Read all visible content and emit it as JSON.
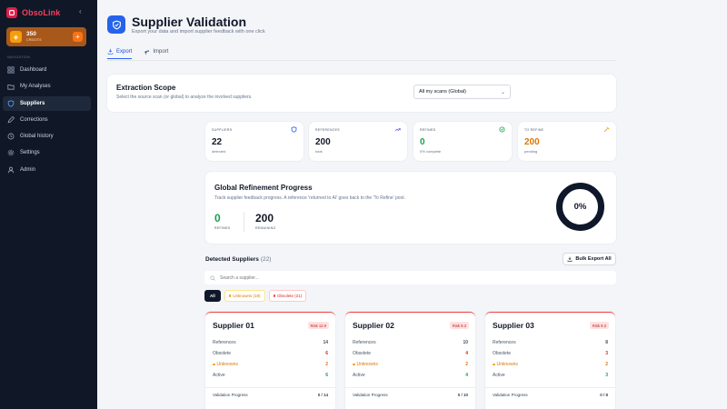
{
  "brand": {
    "name": "ObsoLink"
  },
  "credits": {
    "amount": "350",
    "label": "CREDITS"
  },
  "nav": {
    "title": "NAVIGATION",
    "items": [
      {
        "label": "Dashboard",
        "icon": "grid-icon"
      },
      {
        "label": "My Analyses",
        "icon": "folder-icon"
      },
      {
        "label": "Suppliers",
        "icon": "shield-icon",
        "active": true
      },
      {
        "label": "Corrections",
        "icon": "pencil-icon"
      },
      {
        "label": "Global history",
        "icon": "history-icon"
      },
      {
        "label": "Settings",
        "icon": "gear-icon"
      },
      {
        "label": "Admin",
        "icon": "user-icon"
      }
    ]
  },
  "header": {
    "title": "Supplier Validation",
    "subtitle": "Export your data and import supplier feedback with one click"
  },
  "tabs": [
    {
      "label": "Export",
      "active": true
    },
    {
      "label": "Import",
      "active": false
    }
  ],
  "scope": {
    "title": "Extraction Scope",
    "description": "Select the source scan (or global) to analyze the involved suppliers.",
    "select_value": "All my scans (Global)"
  },
  "stats": [
    {
      "label": "SUPPLIERS",
      "value": "22",
      "sub": "detected",
      "color": "#111827",
      "icon": "shield-icon"
    },
    {
      "label": "REFERENCES",
      "value": "200",
      "sub": "total",
      "color": "#111827",
      "icon": "trend-icon"
    },
    {
      "label": "REFINED",
      "value": "0",
      "sub": "0% complete",
      "color": "#16a34a",
      "icon": "check-circle-icon"
    },
    {
      "label": "TO REFINE",
      "value": "200",
      "sub": "pending",
      "color": "#d97706",
      "icon": "wand-icon"
    }
  ],
  "progress": {
    "title": "Global Refinement Progress",
    "description": "Track supplier feedback progress. A reference 'returned to AI' goes back to the 'To Refine' pool.",
    "refined_value": "0",
    "refined_label": "REFINED",
    "remaining_value": "200",
    "remaining_label": "REMAINING",
    "percent_text": "0%",
    "percent": 0
  },
  "detected": {
    "title": "Detected Suppliers",
    "count": "(22)",
    "bulk_label": "Bulk Export All",
    "search_placeholder": "Search a supplier...",
    "filters": {
      "all": "All",
      "unknowns": "Unknowns (19)",
      "obsolete": "Obsolete (21)"
    }
  },
  "row_labels": {
    "references": "References",
    "obsolete": "Obsolete",
    "unknowns": "Unknowns",
    "active": "Active",
    "validation": "Validation Progress"
  },
  "suppliers": [
    {
      "name": "Supplier 01",
      "risk": "Risk 12.9",
      "references": "14",
      "obsolete": "6",
      "unknowns": "2",
      "active": "6",
      "progress": "0 / 14"
    },
    {
      "name": "Supplier 02",
      "risk": "Risk 9.3",
      "references": "10",
      "obsolete": "4",
      "unknowns": "2",
      "active": "4",
      "progress": "0 / 10"
    },
    {
      "name": "Supplier 03",
      "risk": "Risk 9.3",
      "references": "8",
      "obsolete": "3",
      "unknowns": "2",
      "active": "3",
      "progress": "0 / 8"
    }
  ],
  "colors": {
    "accent": "#2563eb",
    "sidebar": "#101828",
    "danger": "#dc2626",
    "warning": "#d97706",
    "success": "#16a34a"
  }
}
